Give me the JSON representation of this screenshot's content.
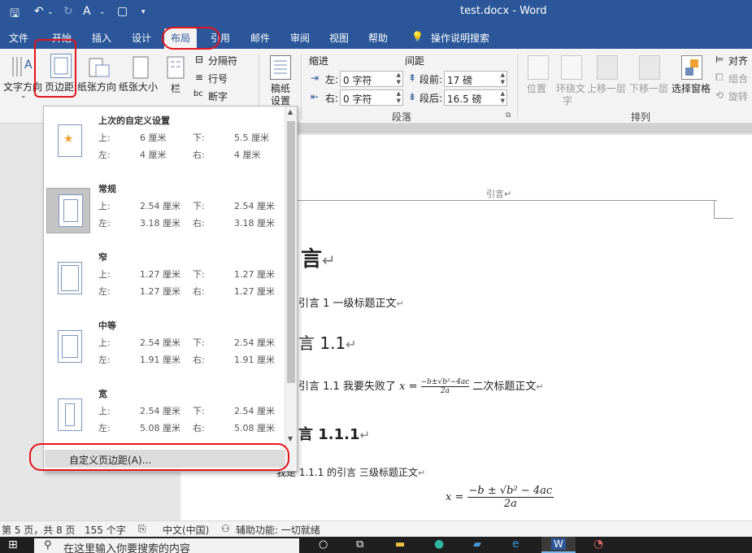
{
  "titlebar": {
    "document_title": "test.docx",
    "separator": "-",
    "app_name": "Word"
  },
  "menu": {
    "tabs": [
      {
        "label": "文件"
      },
      {
        "label": "开始"
      },
      {
        "label": "插入"
      },
      {
        "label": "设计"
      },
      {
        "label": "布局"
      },
      {
        "label": "引用"
      },
      {
        "label": "邮件"
      },
      {
        "label": "审阅"
      },
      {
        "label": "视图"
      },
      {
        "label": "帮助"
      }
    ],
    "tell_me": "操作说明搜索"
  },
  "ribbon": {
    "page_setup": {
      "text_direction": "文字方向",
      "margins": "页边距",
      "orientation": "纸张方向",
      "size": "纸张大小",
      "columns": "栏",
      "breaks": "分隔符",
      "line_numbers": "行号",
      "hyphenation": "断字"
    },
    "draft": {
      "label_line1": "稿纸",
      "label_line2": "设置"
    },
    "paragraph": {
      "indent_header": "缩进",
      "spacing_header": "间距",
      "left_label": "左:",
      "right_label": "右:",
      "before_label": "段前:",
      "after_label": "段后:",
      "indent_left": "0 字符",
      "indent_right": "0 字符",
      "spacing_before": "17 磅",
      "spacing_after": "16.5 磅",
      "group_label": "段落"
    },
    "arrange": {
      "position": "位置",
      "wrap_line1": "环绕文",
      "wrap_line2": "字",
      "bring_forward": "上移一层",
      "send_backward": "下移一层",
      "selection_pane": "选择窗格",
      "align": "对齐",
      "group": "组合",
      "rotate": "旋转",
      "group_label": "排列"
    }
  },
  "margins_dropdown": {
    "presets": [
      {
        "name": "上次的自定义设置",
        "top_label": "上:",
        "top": "6 厘米",
        "bottom_label": "下:",
        "bottom": "5.5 厘米",
        "left_label": "左:",
        "left": "4 厘米",
        "right_label": "右:",
        "right": "4 厘米"
      },
      {
        "name": "常规",
        "top_label": "上:",
        "top": "2.54 厘米",
        "bottom_label": "下:",
        "bottom": "2.54 厘米",
        "left_label": "左:",
        "left": "3.18 厘米",
        "right_label": "右:",
        "right": "3.18 厘米"
      },
      {
        "name": "窄",
        "top_label": "上:",
        "top": "1.27 厘米",
        "bottom_label": "下:",
        "bottom": "1.27 厘米",
        "left_label": "左:",
        "left": "1.27 厘米",
        "right_label": "右:",
        "right": "1.27 厘米"
      },
      {
        "name": "中等",
        "top_label": "上:",
        "top": "2.54 厘米",
        "bottom_label": "下:",
        "bottom": "2.54 厘米",
        "left_label": "左:",
        "left": "1.91 厘米",
        "right_label": "右:",
        "right": "1.91 厘米"
      },
      {
        "name": "宽",
        "top_label": "上:",
        "top": "2.54 厘米",
        "bottom_label": "下:",
        "bottom": "2.54 厘米",
        "left_label": "左:",
        "left": "5.08 厘米",
        "right_label": "右:",
        "right": "5.08 厘米"
      }
    ],
    "custom_margins": "自定义页边距(A)..."
  },
  "document": {
    "header_text": "引言",
    "heading1": "言",
    "body1": "引言 1  一级标题正文",
    "heading2": "言 1.1",
    "body2_prefix": "引言 1.1  我要失败了",
    "formula_x": "x",
    "formula_eq": "=",
    "formula_num": "−b±√b²−4ac",
    "formula_den": "2a",
    "body2_suffix": "二次标题正文",
    "heading3": "言 1.1.1",
    "body3": "我是 1.1.1 的引言  三级标题正文",
    "display_x": "x",
    "display_eq": "=",
    "display_num": "−b ± √b² − 4ac",
    "display_den": "2a",
    "para_mark": "↵"
  },
  "statusbar": {
    "page": "第 5 页，共 8 页",
    "words": "155 个字",
    "language": "中文(中国)",
    "accessibility": "辅助功能: 一切就绪"
  },
  "taskbar": {
    "search_placeholder": "在这里输入你要搜索的内容"
  },
  "colors": {
    "word_blue": "#2b579a",
    "annotation_red": "#e3141c"
  }
}
